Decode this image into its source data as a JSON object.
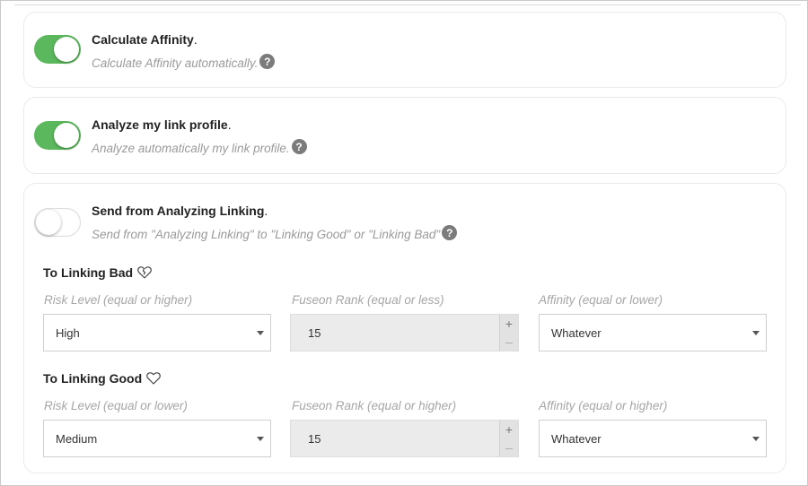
{
  "settings": [
    {
      "title": "Calculate Affinity",
      "suffix": ".",
      "description": "Calculate Affinity automatically.",
      "enabled": true
    },
    {
      "title": "Analyze my link profile",
      "suffix": ".",
      "description": "Analyze automatically my link profile.",
      "enabled": true
    },
    {
      "title": "Send from Analyzing Linking",
      "suffix": ".",
      "description": "Send from \"Analyzing Linking\" to \"Linking Good\" or \"Linking Bad\"",
      "enabled": false
    }
  ],
  "help_icon_glyph": "?",
  "linking_bad": {
    "title": "To Linking Bad",
    "icon": "broken-heart-icon",
    "risk_label": "Risk Level (equal or higher)",
    "risk_value": "High",
    "rank_label": "Fuseon Rank (equal or less)",
    "rank_value": "15",
    "affinity_label": "Affinity (equal or lower)",
    "affinity_value": "Whatever"
  },
  "linking_good": {
    "title": "To Linking Good",
    "icon": "heart-icon",
    "risk_label": "Risk Level (equal or lower)",
    "risk_value": "Medium",
    "rank_label": "Fuseon Rank (equal or higher)",
    "rank_value": "15",
    "affinity_label": "Affinity (equal or higher)",
    "affinity_value": "Whatever"
  },
  "stepper": {
    "plus": "+",
    "minus": "–"
  },
  "colors": {
    "toggle_on": "#5cb85c",
    "help_icon": "#7b7b7b",
    "muted_text": "#9a9a9a"
  }
}
